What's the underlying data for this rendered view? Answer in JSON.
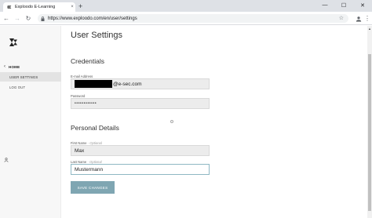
{
  "browser": {
    "tab_title": "Exploodo E-Learning",
    "url": "https://www.exploodo.com/en/user/settings"
  },
  "sidebar": {
    "home_label": "HOME",
    "items": [
      {
        "label": "USER SETTINGS",
        "active": true
      },
      {
        "label": "LOG OUT",
        "active": false
      }
    ]
  },
  "main": {
    "page_title": "User Settings",
    "credentials": {
      "title": "Credentials",
      "email_label": "E-mail Address",
      "email_suffix": "@e-sec.com",
      "password_label": "Password",
      "password_value": "••••••••••••"
    },
    "personal": {
      "title": "Personal Details",
      "first_name_label": "First Name",
      "first_name_optional": "- Optional",
      "first_name_value": "Max",
      "last_name_label": "Last Name",
      "last_name_optional": "- Optional",
      "last_name_value": "Mustermann"
    },
    "save_label": "SAVE CHANGES"
  },
  "colors": {
    "accent": "#7fa6b2",
    "sidebar_bg": "#f7f7f7",
    "input_bg": "#ececec"
  }
}
